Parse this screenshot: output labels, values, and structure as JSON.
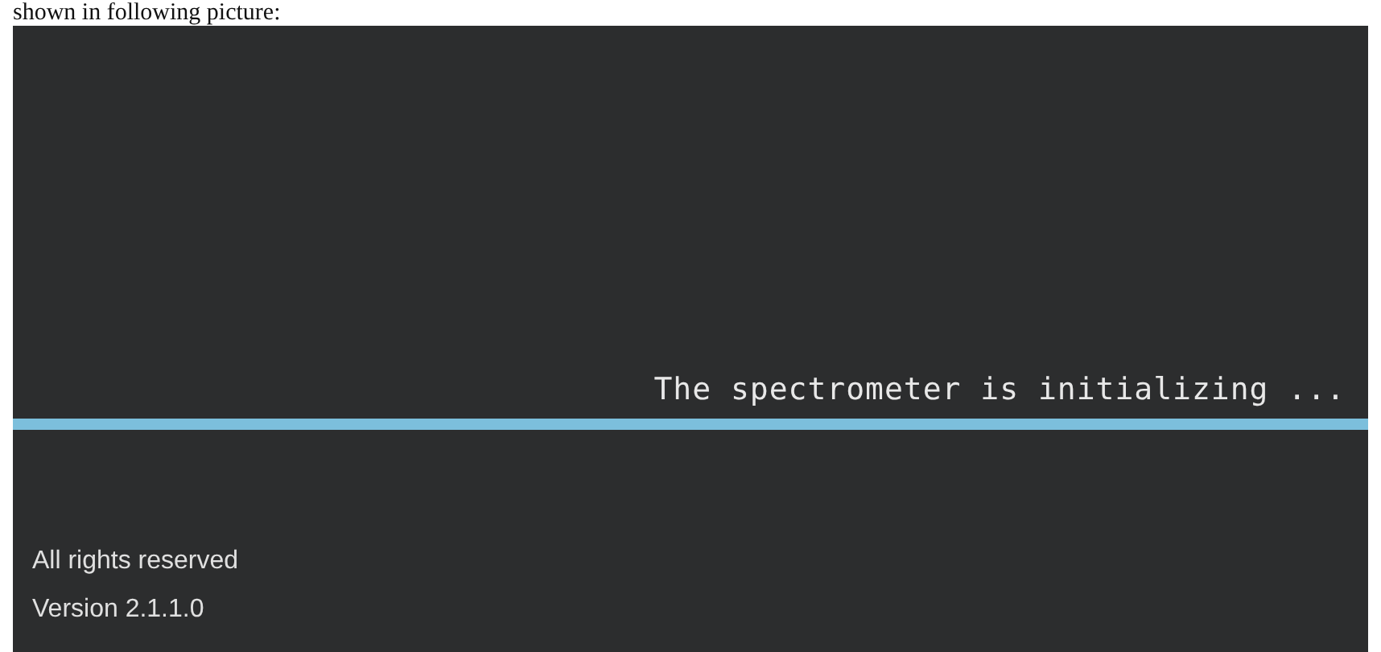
{
  "caption": "shown in following picture:",
  "splash": {
    "status": "The spectrometer is initializing ...",
    "footer": [
      "All rights reserved",
      "Version 2.1.1.0"
    ]
  }
}
